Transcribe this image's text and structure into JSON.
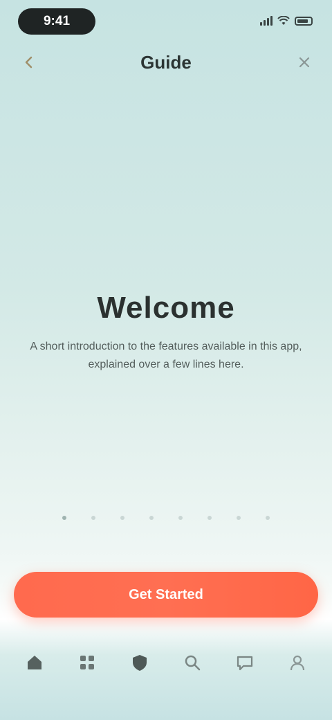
{
  "status_bar": {
    "time": "9:41",
    "icons": [
      "signal-icon",
      "wifi-icon",
      "battery-icon"
    ]
  },
  "header": {
    "title": "Guide",
    "back_icon": "back-arrow-icon",
    "close_icon": "close-icon"
  },
  "main": {
    "title": "Welcome",
    "description": "A short introduction to the features available in this app, explained over a few lines here."
  },
  "pager": {
    "count": 8,
    "active_index": 0
  },
  "cta": {
    "label": "Get Started",
    "color": "#ff6a4e"
  },
  "tab_bar": {
    "items": [
      {
        "icon": "home-icon",
        "label": ""
      },
      {
        "icon": "grid-icon",
        "label": ""
      },
      {
        "icon": "shield-icon",
        "label": ""
      },
      {
        "icon": "search-icon",
        "label": ""
      },
      {
        "icon": "chat-icon",
        "label": ""
      },
      {
        "icon": "user-icon",
        "label": ""
      }
    ]
  },
  "colors": {
    "background_top": "#c6e3e2",
    "background_mid": "#eef6f4",
    "accent": "#ff6a4e"
  }
}
